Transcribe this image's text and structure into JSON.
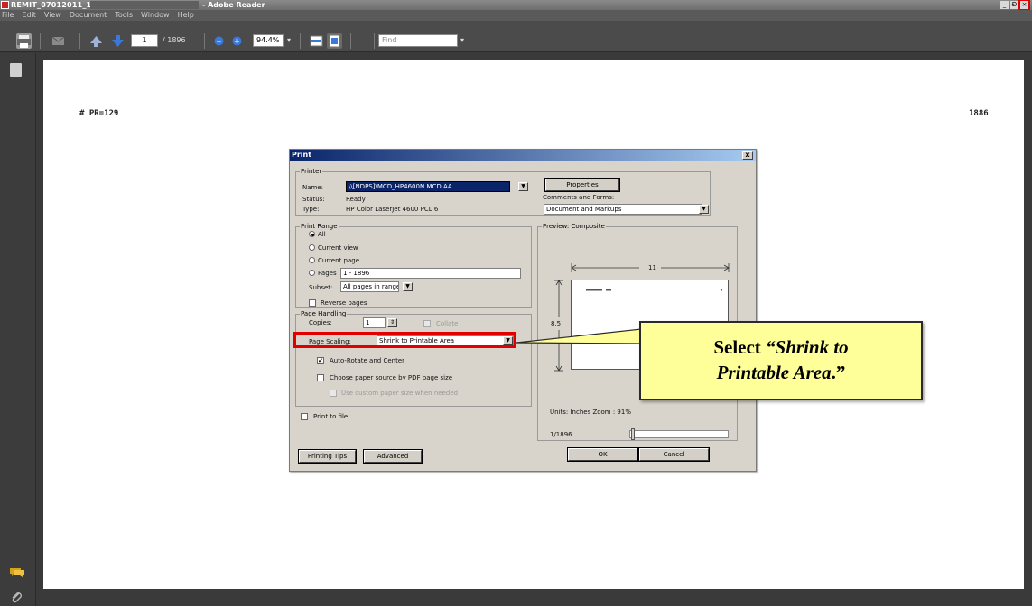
{
  "window": {
    "doc_name": "REMIT_07012011_1",
    "app_name": "- Adobe Reader",
    "minimize": "_",
    "restore": "Ð",
    "close": "×"
  },
  "menu": [
    "File",
    "Edit",
    "View",
    "Document",
    "Tools",
    "Window",
    "Help"
  ],
  "toolbar": {
    "page_current": "1",
    "page_total": "/ 1896",
    "zoom": "94.4%",
    "zoom_arrow": "▾",
    "find_placeholder": "Find",
    "find_arrow": "▾"
  },
  "document": {
    "header_left": "# PR=129",
    "header_dot": ".",
    "header_right": "1886"
  },
  "dialog": {
    "title": "Print",
    "close": "x",
    "printer_group": "Printer",
    "name_label": "Name:",
    "name_value": "\\\\[NDPS]\\MCD_HP4600N.MCD.AA",
    "status_label": "Status:",
    "status_value": "Ready",
    "type_label": "Type:",
    "type_value": "HP Color LaserJet 4600 PCL 6",
    "properties_button": "Properties",
    "comments_label": "Comments and Forms:",
    "comments_value": "Document and Markups",
    "range_group": "Print Range",
    "range_all": "All",
    "range_current_view": "Current view",
    "range_current_page": "Current page",
    "range_pages": "Pages",
    "range_pages_value": "1 - 1896",
    "subset_label": "Subset:",
    "subset_value": "All pages in range",
    "reverse_pages": "Reverse pages",
    "handling_group": "Page Handling",
    "copies_label": "Copies:",
    "copies_value": "1",
    "collate": "Collate",
    "scaling_label": "Page Scaling:",
    "scaling_value": "Shrink to Printable Area",
    "auto_rotate": "Auto-Rotate and Center",
    "auto_rotate_check": "✔",
    "paper_source": "Choose paper source by PDF page size",
    "custom_paper": "Use custom paper size when needed",
    "print_to_file": "Print to file",
    "preview_group": "Preview: Composite",
    "preview_width": "11",
    "preview_height": "8.5",
    "units_zoom": "Units: Inches Zoom : 91%",
    "page_counter": "1/1896",
    "printing_tips_button": "Printing Tips",
    "advanced_button": "Advanced",
    "ok_button": "OK",
    "cancel_button": "Cancel",
    "dd_arrow": "▼"
  },
  "callout": {
    "line1_prefix": "Select ",
    "line1_italic": "“Shrink to",
    "line2_italic": "Printable Area",
    "line2_suffix": ".”"
  },
  "colors": {
    "highlight": "#e00000",
    "callout_bg": "#ffff99",
    "dialog_bg": "#d8d4cc",
    "title_blue": "#0a246a"
  }
}
